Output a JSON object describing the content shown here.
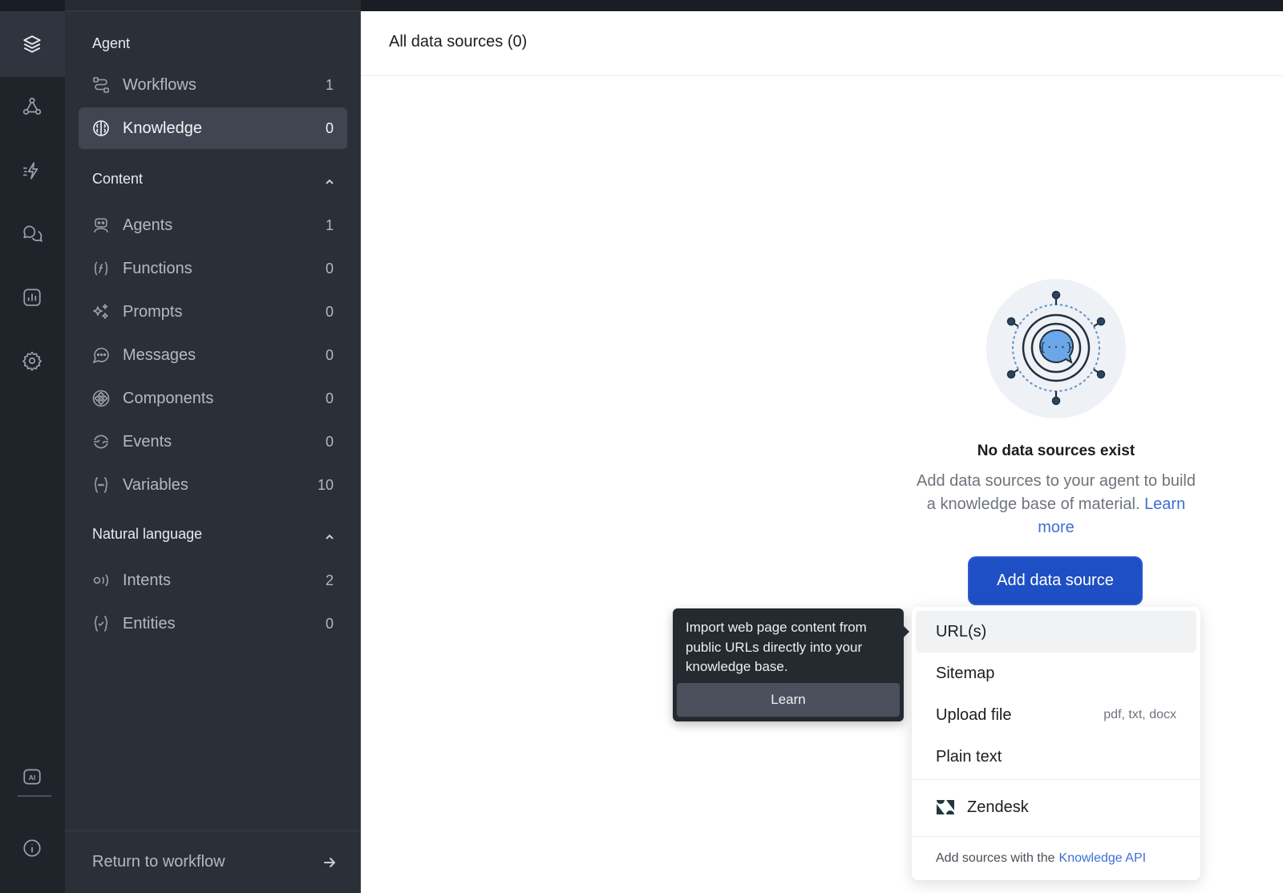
{
  "rail": {
    "icons": [
      "layers-icon",
      "workflow-graph-icon",
      "lightning-icon",
      "chat-bubbles-icon",
      "analytics-icon",
      "settings-icon",
      "ai-icon",
      "info-icon"
    ]
  },
  "sidebar": {
    "agent_heading": "Agent",
    "agent_items": [
      {
        "label": "Workflows",
        "count": "1",
        "icon": "workflow-icon"
      },
      {
        "label": "Knowledge",
        "count": "0",
        "icon": "brain-icon",
        "active": true
      }
    ],
    "content_heading": "Content",
    "content_items": [
      {
        "label": "Agents",
        "count": "1",
        "icon": "robot-icon"
      },
      {
        "label": "Functions",
        "count": "0",
        "icon": "function-icon"
      },
      {
        "label": "Prompts",
        "count": "0",
        "icon": "sparkle-icon"
      },
      {
        "label": "Messages",
        "count": "0",
        "icon": "message-icon"
      },
      {
        "label": "Components",
        "count": "0",
        "icon": "components-icon"
      },
      {
        "label": "Events",
        "count": "0",
        "icon": "events-icon"
      },
      {
        "label": "Variables",
        "count": "10",
        "icon": "variables-icon"
      }
    ],
    "nl_heading": "Natural language",
    "nl_items": [
      {
        "label": "Intents",
        "count": "2",
        "icon": "intent-icon"
      },
      {
        "label": "Entities",
        "count": "0",
        "icon": "entity-icon"
      }
    ],
    "footer_label": "Return to workflow"
  },
  "main": {
    "title": "All data sources (0)",
    "empty_title": "No data sources exist",
    "empty_desc": "Add data sources to your agent to build a knowledge base of material.",
    "learn_more": "Learn more",
    "add_button": "Add data source"
  },
  "dropdown": {
    "items": [
      {
        "label": "URL(s)",
        "hint": ""
      },
      {
        "label": "Sitemap",
        "hint": ""
      },
      {
        "label": "Upload file",
        "hint": "pdf, txt, docx"
      },
      {
        "label": "Plain text",
        "hint": ""
      }
    ],
    "zendesk_label": "Zendesk",
    "footer_pre": "Add sources with the",
    "footer_link": "Knowledge API"
  },
  "tooltip": {
    "text": "Import web page content from public URLs directly into your knowledge base.",
    "button": "Learn"
  },
  "colors": {
    "rail_bg": "#1f242b",
    "sidebar_bg": "#2b3038",
    "active_item": "#3f4652",
    "primary": "#1f4fc4",
    "link": "#3d6fd6"
  }
}
